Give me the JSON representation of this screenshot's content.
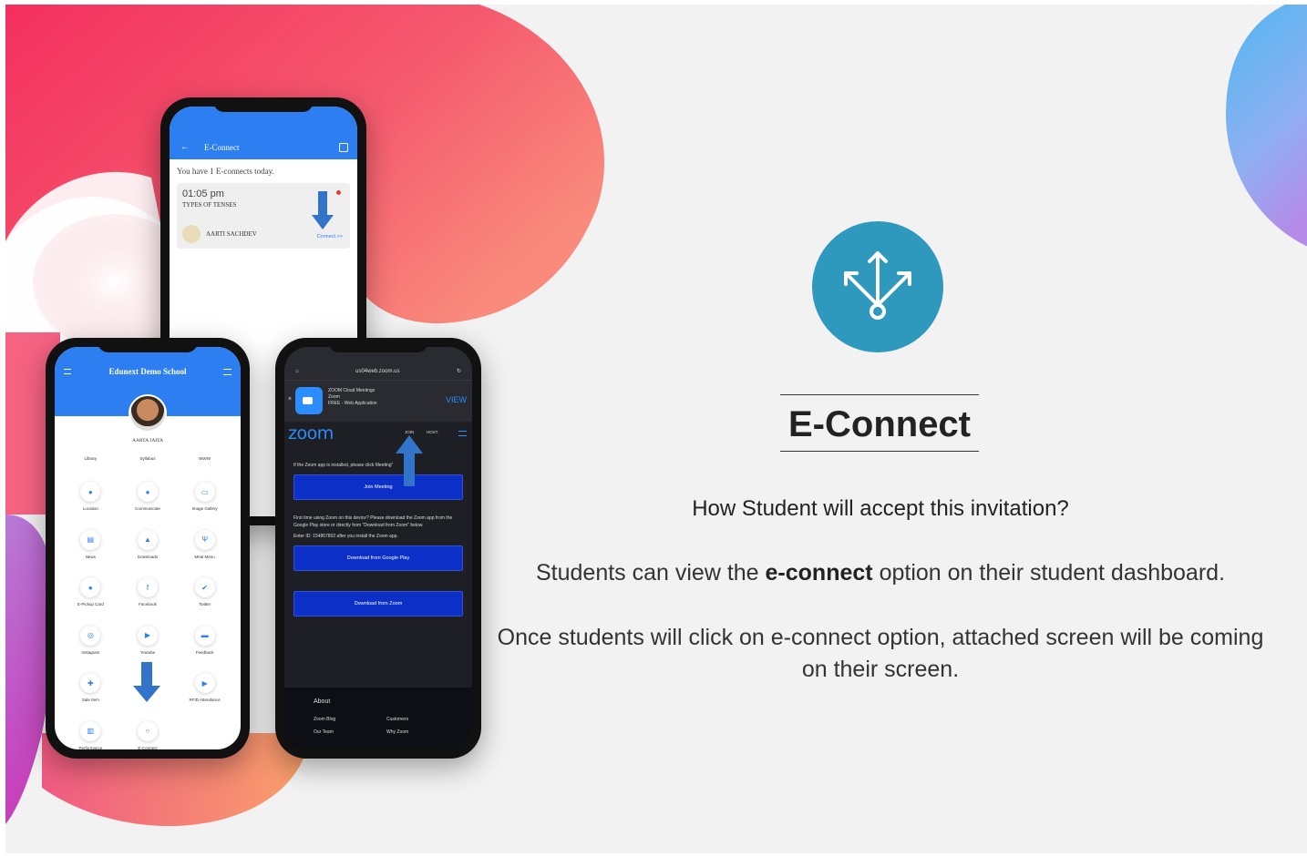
{
  "colors": {
    "accent": "#2f98bd",
    "app_blue": "#2d7ef0",
    "zoom_blue": "#2d8cff",
    "pink": "#f2416b"
  },
  "icon": {
    "name": "share-arrows-icon"
  },
  "heading": "E-Connect",
  "question": "How Student will accept this invitation?",
  "para1": {
    "before": "Students can view the ",
    "bold": "e-connect",
    "after": " option on their student dashboard."
  },
  "para2": "Once students will click on e-connect option, attached screen will be coming on their screen.",
  "phone1": {
    "title": "E-Connect",
    "info": "You have 1 E-connects today.",
    "time": "01:05 pm",
    "topic": "TYPES OF TENSES",
    "teacher": "AARTI SACHDEV",
    "connect_label": "Connect >>"
  },
  "phone2": {
    "school": "Edunext Demo School",
    "user": "AARTA JAITA",
    "tiles": [
      {
        "label": "Library",
        "icon": ""
      },
      {
        "label": "Syllabus",
        "icon": ""
      },
      {
        "label": "WWW",
        "icon": ""
      },
      {
        "label": "Location",
        "icon": "●"
      },
      {
        "label": "Communicate",
        "icon": "●"
      },
      {
        "label": "Image Gallery",
        "icon": "▭"
      },
      {
        "label": "News",
        "icon": "▤"
      },
      {
        "label": "Downloads",
        "icon": "▲"
      },
      {
        "label": "Meal Menu",
        "icon": "Ψ"
      },
      {
        "label": "E-Pickup Card",
        "icon": "●"
      },
      {
        "label": "Facebook",
        "icon": "f"
      },
      {
        "label": "Twitter",
        "icon": "✔"
      },
      {
        "label": "Instagram",
        "icon": "◎"
      },
      {
        "label": "Youtube",
        "icon": "▶"
      },
      {
        "label": "Feedback",
        "icon": "▬"
      },
      {
        "label": "Sale Item",
        "icon": "✚"
      },
      {
        "label": "",
        "icon": ""
      },
      {
        "label": "RFID Attendance",
        "icon": "▶"
      },
      {
        "label": "Performance",
        "icon": "▥"
      },
      {
        "label": "E-Connect",
        "icon": "○"
      },
      {
        "label": "",
        "icon": ""
      }
    ]
  },
  "phone3": {
    "url": "us04web.zoom.us",
    "app_name": "ZOOM Cloud Meetings",
    "app_publisher": "Zoom",
    "app_free": "FREE - Web Application",
    "view": "VIEW",
    "zoom_logo": "zoom",
    "join": "JOIN",
    "host": "HOST",
    "msg1": "If the Zoom app is installed, please click Meeting\"",
    "join_btn": "Join Meeting",
    "msg2": "First time using Zoom on this device? Please download the Zoom app from the Google Play store or directly from \"Download from Zoom\" below.",
    "msg3": "Enter ID: 154867802 after you install the Zoom app.",
    "gp_btn": "Download from Google Play",
    "zoom_btn": "Download from Zoom",
    "about": "About",
    "f1": "Zoom Blog",
    "f2": "Our Team",
    "f3": "Customers",
    "f4": "Why Zoom"
  }
}
